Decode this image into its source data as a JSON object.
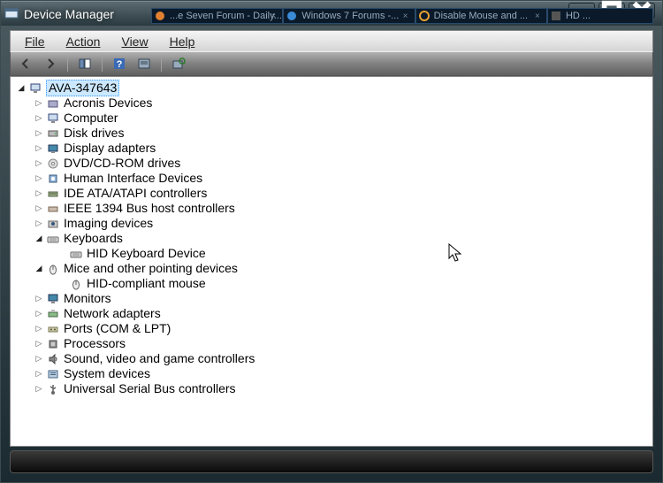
{
  "window": {
    "title": "Device Manager"
  },
  "browser_tabs": [
    {
      "label": "...e Seven Forum - Daily..."
    },
    {
      "label": "Windows 7 Forums -..."
    },
    {
      "label": "Disable Mouse and ..."
    },
    {
      "label": "HD ..."
    }
  ],
  "menubar": {
    "file": "File",
    "action": "Action",
    "view": "View",
    "help": "Help"
  },
  "tree": {
    "root": "AVA-347643",
    "categories": [
      {
        "label": "Acronis Devices",
        "icon": "generic"
      },
      {
        "label": "Computer",
        "icon": "computer"
      },
      {
        "label": "Disk drives",
        "icon": "disk"
      },
      {
        "label": "Display adapters",
        "icon": "display"
      },
      {
        "label": "DVD/CD-ROM drives",
        "icon": "dvd"
      },
      {
        "label": "Human Interface Devices",
        "icon": "hid"
      },
      {
        "label": "IDE ATA/ATAPI controllers",
        "icon": "ide"
      },
      {
        "label": "IEEE 1394 Bus host controllers",
        "icon": "ieee"
      },
      {
        "label": "Imaging devices",
        "icon": "imaging"
      },
      {
        "label": "Keyboards",
        "icon": "keyboard",
        "expanded": true,
        "children": [
          {
            "label": "HID Keyboard Device",
            "icon": "keyboard"
          }
        ]
      },
      {
        "label": "Mice and other pointing devices",
        "icon": "mouse",
        "expanded": true,
        "children": [
          {
            "label": "HID-compliant mouse",
            "icon": "mouse"
          }
        ]
      },
      {
        "label": "Monitors",
        "icon": "monitor"
      },
      {
        "label": "Network adapters",
        "icon": "network"
      },
      {
        "label": "Ports (COM & LPT)",
        "icon": "port"
      },
      {
        "label": "Processors",
        "icon": "cpu"
      },
      {
        "label": "Sound, video and game controllers",
        "icon": "sound"
      },
      {
        "label": "System devices",
        "icon": "system"
      },
      {
        "label": "Universal Serial Bus controllers",
        "icon": "usb"
      }
    ]
  }
}
